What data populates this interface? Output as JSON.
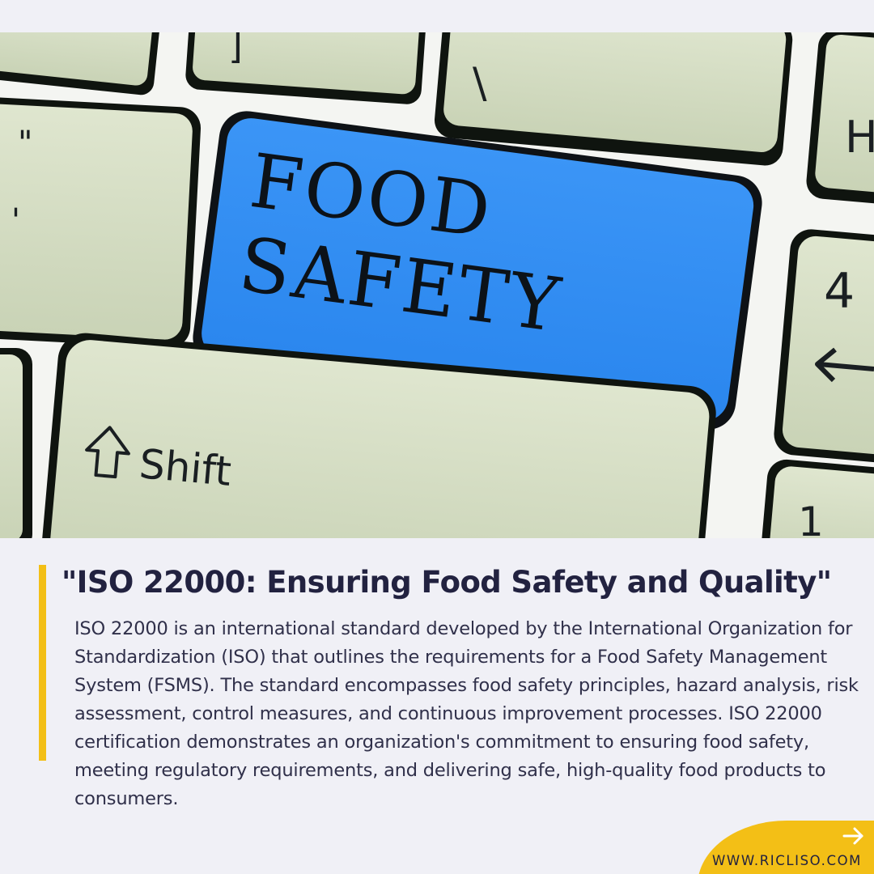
{
  "hero": {
    "key_highlight": {
      "line1": "FOOD",
      "line2": "SAFETY",
      "color": "#2f8ef4"
    },
    "key_shift_label": "Shift",
    "key_glyphs": {
      "top_left": "]",
      "top_mid": "\\",
      "quote": "\"",
      "apostrophe": "'",
      "h": "H",
      "four": "4",
      "one": "1"
    },
    "icons": {
      "shift": "shift-arrow-icon",
      "backspace": "left-arrow-icon"
    }
  },
  "article": {
    "title": "\"ISO 22000: Ensuring Food Safety and Quality\"",
    "body": "ISO 22000 is an international standard developed by the International Organization for Standardization (ISO) that outlines the requirements for a Food Safety Management System (FSMS). The standard encompasses food safety principles, hazard analysis, risk assessment, control measures, and continuous improvement processes. ISO 22000 certification demonstrates an organization's commitment to ensuring food safety, meeting regulatory requirements, and delivering safe, high-quality food products to consumers."
  },
  "footer": {
    "website": "WWW.RICLISO.COM",
    "icon": "right-arrow-icon"
  },
  "colors": {
    "accent": "#f3bf16",
    "text_dark": "#222240",
    "background": "#f0f0f6"
  }
}
